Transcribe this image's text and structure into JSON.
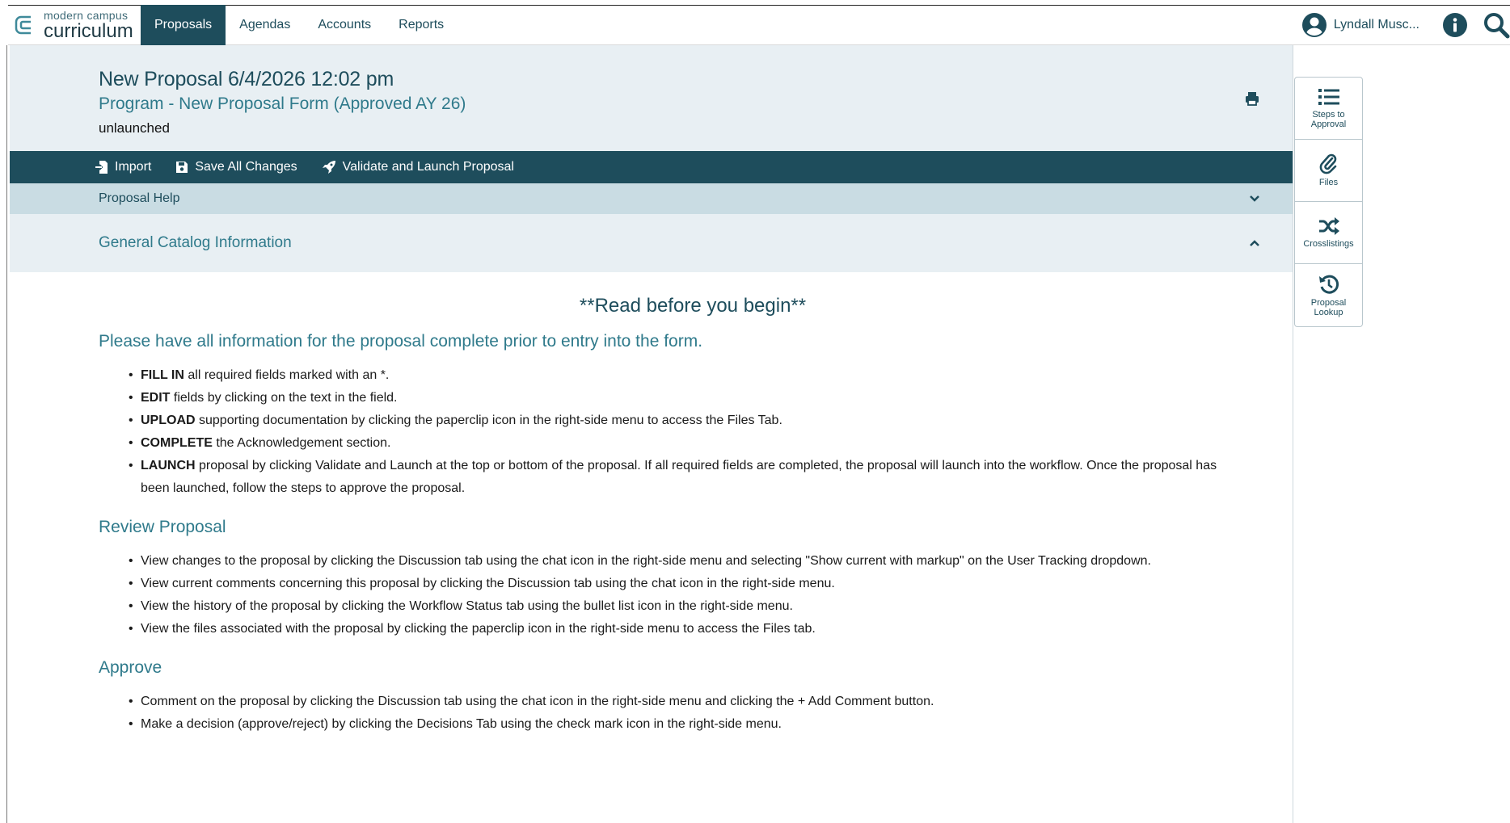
{
  "logo": {
    "small": "modern campus",
    "big": "curriculum"
  },
  "nav": {
    "items": [
      {
        "label": "Proposals",
        "active": true
      },
      {
        "label": "Agendas"
      },
      {
        "label": "Accounts"
      },
      {
        "label": "Reports"
      }
    ]
  },
  "user": {
    "name": "Lyndall Musc..."
  },
  "header": {
    "title": "New Proposal 6/4/2026 12:02 pm",
    "subtitle": "Program - New Proposal Form (Approved AY 26)",
    "state": "unlaunched"
  },
  "toolbar": {
    "import_label": "Import",
    "save_label": "Save All Changes",
    "launch_label": "Validate and Launch Proposal"
  },
  "help": {
    "label": "Proposal Help"
  },
  "section": {
    "label": "General Catalog Information"
  },
  "content": {
    "read_title": "**Read before you begin**",
    "intro": "Please have all information for the proposal complete prior to entry into the form.",
    "steps": [
      {
        "bold": "FILL IN",
        "text": " all required fields marked with an *."
      },
      {
        "bold": "EDIT",
        "text": " fields by clicking on the text in the field."
      },
      {
        "bold": "UPLOAD",
        "text": " supporting documentation by clicking the paperclip icon in the right-side menu to access the Files Tab."
      },
      {
        "bold": "COMPLETE",
        "text": " the Acknowledgement section."
      },
      {
        "bold": "LAUNCH",
        "text": " proposal by clicking Validate and Launch at the top or bottom of the proposal.  If all required fields are completed, the proposal will launch into the workflow. Once the proposal has been launched, follow the steps to approve the proposal."
      }
    ],
    "review_heading": "Review Proposal",
    "review_items": [
      "View changes to the proposal by clicking the Discussion tab using the chat icon in the right-side menu and selecting \"Show current with markup\" on the User Tracking dropdown.",
      "View current comments concerning this proposal by clicking the Discussion tab using the chat icon in the right-side menu.",
      "View the history of the proposal by clicking the Workflow Status tab using the bullet list icon in the right-side menu.",
      "View the files associated with the proposal by clicking the paperclip icon in the right-side menu to access the Files tab."
    ],
    "approve_heading": "Approve",
    "approve_items": [
      "Comment on the proposal by clicking the Discussion tab using the chat icon in the right-side menu and clicking the + Add Comment button.",
      "Make a decision (approve/reject) by clicking the Decisions Tab using the check mark icon in the right-side menu."
    ]
  },
  "side_panel": {
    "items": [
      {
        "label": "Steps to Approval",
        "icon": "list-icon"
      },
      {
        "label": "Files",
        "icon": "paperclip-icon"
      },
      {
        "label": "Crosslistings",
        "icon": "shuffle-icon"
      },
      {
        "label": "Proposal Lookup",
        "icon": "history-icon"
      }
    ]
  },
  "colors": {
    "brand": "#1e4d5c",
    "accent": "#2f7a8b",
    "header_bg": "#e8eff3",
    "help_bg": "#c9dce3"
  }
}
